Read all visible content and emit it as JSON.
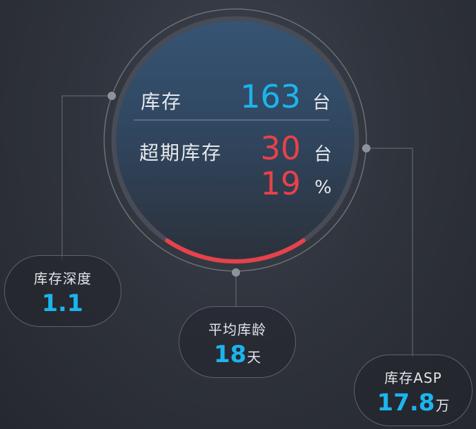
{
  "circle": {
    "stock": {
      "label": "库存",
      "value": "163",
      "unit": "台"
    },
    "overdue": {
      "label": "超期库存",
      "value": "30",
      "unit": "台"
    },
    "overdue_pct": {
      "value": "19",
      "unit": "%"
    },
    "progress": 0.19
  },
  "bubbles": {
    "depth": {
      "title": "库存深度",
      "value": "1.1",
      "unit": ""
    },
    "avg_age": {
      "title": "平均库龄",
      "value": "18",
      "unit": "天"
    },
    "asp": {
      "title": "库存ASP",
      "value": "17.8",
      "unit": "万"
    }
  },
  "colors": {
    "accent_blue": "#1cb4ee",
    "alert_red": "#e8414a",
    "text_light": "#e7e9ed"
  }
}
